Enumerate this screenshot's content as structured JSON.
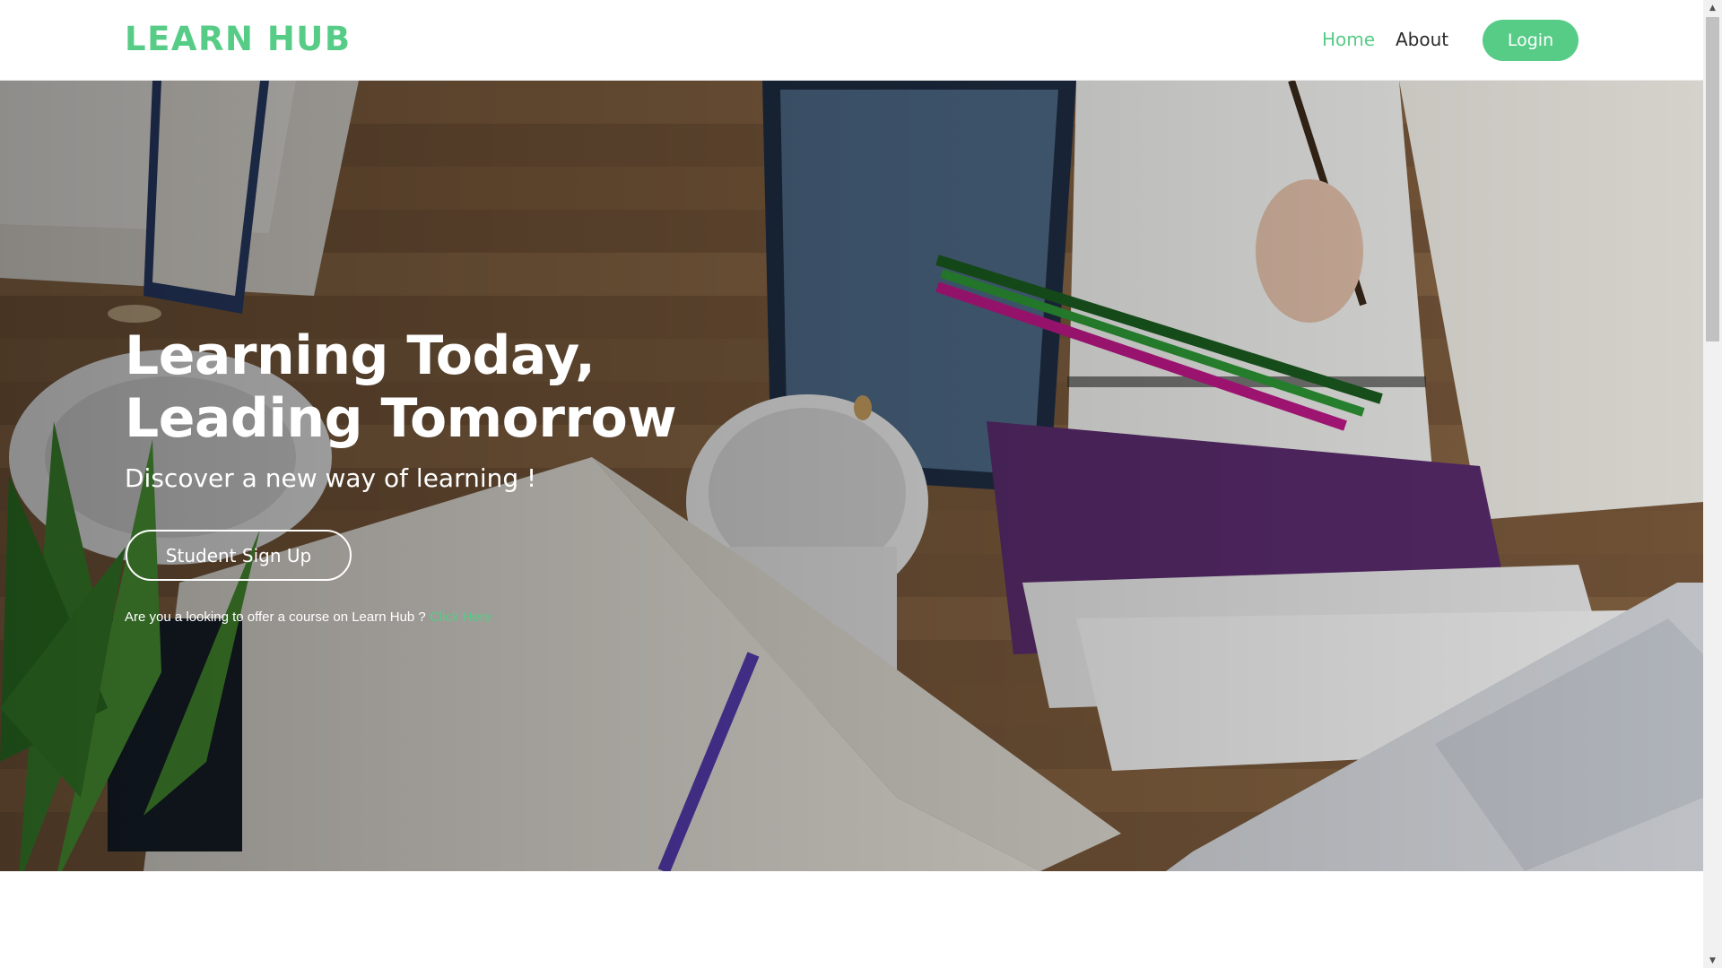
{
  "header": {
    "logo": "LEARN HUB",
    "nav": {
      "home": "Home",
      "about": "About"
    },
    "login_label": "Login"
  },
  "hero": {
    "title_line1": "Learning Today,",
    "title_line2": "Leading Tomorrow",
    "subtitle": "Discover a new way of learning !",
    "signup_label": "Student Sign Up",
    "offer_text": "Are you a looking to offer a course on Learn Hub ?",
    "offer_link": "Click Here"
  },
  "scrollbar": {
    "up_icon": "▲",
    "down_icon": "▼"
  },
  "colors": {
    "accent": "#57cc87",
    "text_dark": "#2b2b2b",
    "white": "#ffffff"
  }
}
